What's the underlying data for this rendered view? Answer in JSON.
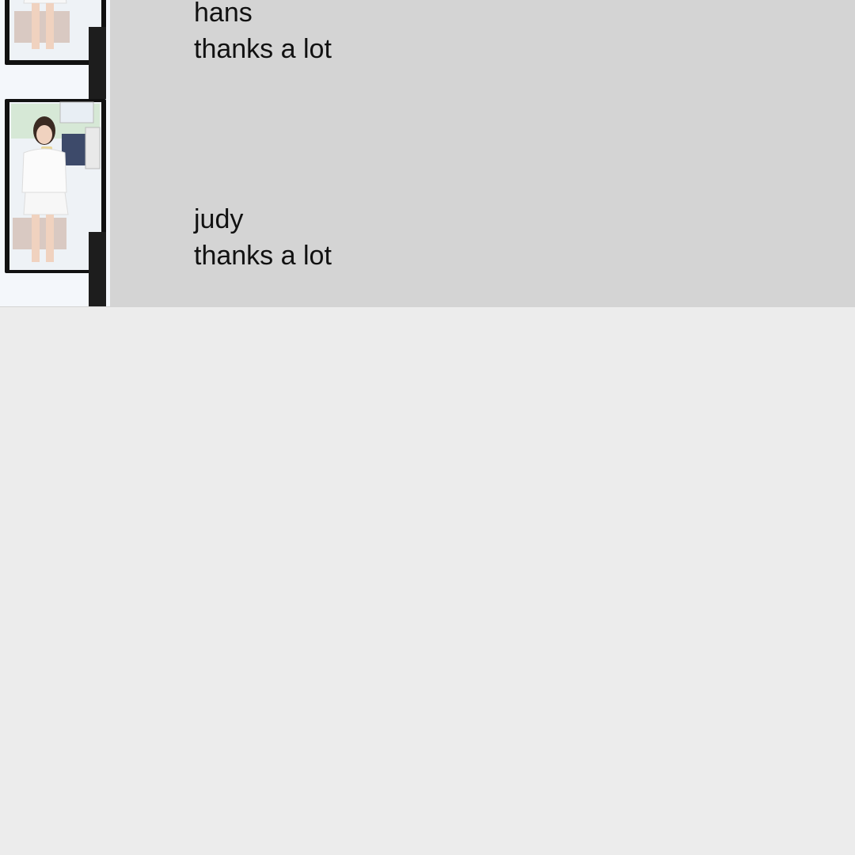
{
  "contacts": [
    {
      "name": "hans",
      "message": "thanks a lot",
      "avatar_icon": "selfie-photo"
    },
    {
      "name": "judy",
      "message": "thanks a lot",
      "avatar_icon": "selfie-photo"
    }
  ],
  "colors": {
    "list_background": "#d4d4d4",
    "page_background": "#ececec",
    "text": "#111111"
  }
}
